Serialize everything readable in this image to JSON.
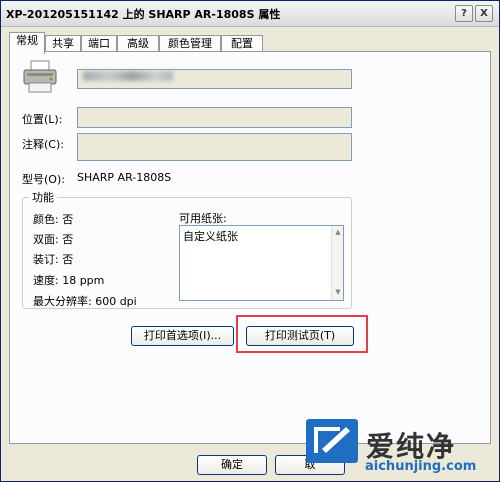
{
  "window": {
    "title": "XP-201205151142 上的 SHARP AR-1808S 属性",
    "help_label": "?",
    "close_label": "X"
  },
  "tabs": [
    {
      "label": "常规",
      "active": true
    },
    {
      "label": "共享",
      "active": false
    },
    {
      "label": "端口",
      "active": false
    },
    {
      "label": "高级",
      "active": false
    },
    {
      "label": "颜色管理",
      "active": false
    },
    {
      "label": "配置",
      "active": false
    }
  ],
  "general": {
    "location_label": "位置(L):",
    "location_value": "",
    "comment_label": "注释(C):",
    "comment_value": "",
    "model_label": "型号(O):",
    "model_value": "SHARP AR-1808S"
  },
  "features": {
    "title": "功能",
    "color": "颜色: 否",
    "duplex": "双面: 否",
    "staple": "装订: 否",
    "speed": "速度: 18 ppm",
    "max_resolution": "最大分辨率: 600 dpi",
    "paper_label": "可用纸张:",
    "paper_items": [
      "自定义纸张"
    ]
  },
  "buttons": {
    "preferences": "打印首选项(I)...",
    "test_page": "打印测试页(T)",
    "ok": "确定",
    "cancel": "取"
  },
  "watermark": {
    "brand": "爱纯净",
    "url": "aichunjing.com"
  },
  "colors": {
    "highlight": "#e0404a",
    "dialog_bg": "#ece9d8",
    "button_border": "#003c74"
  }
}
